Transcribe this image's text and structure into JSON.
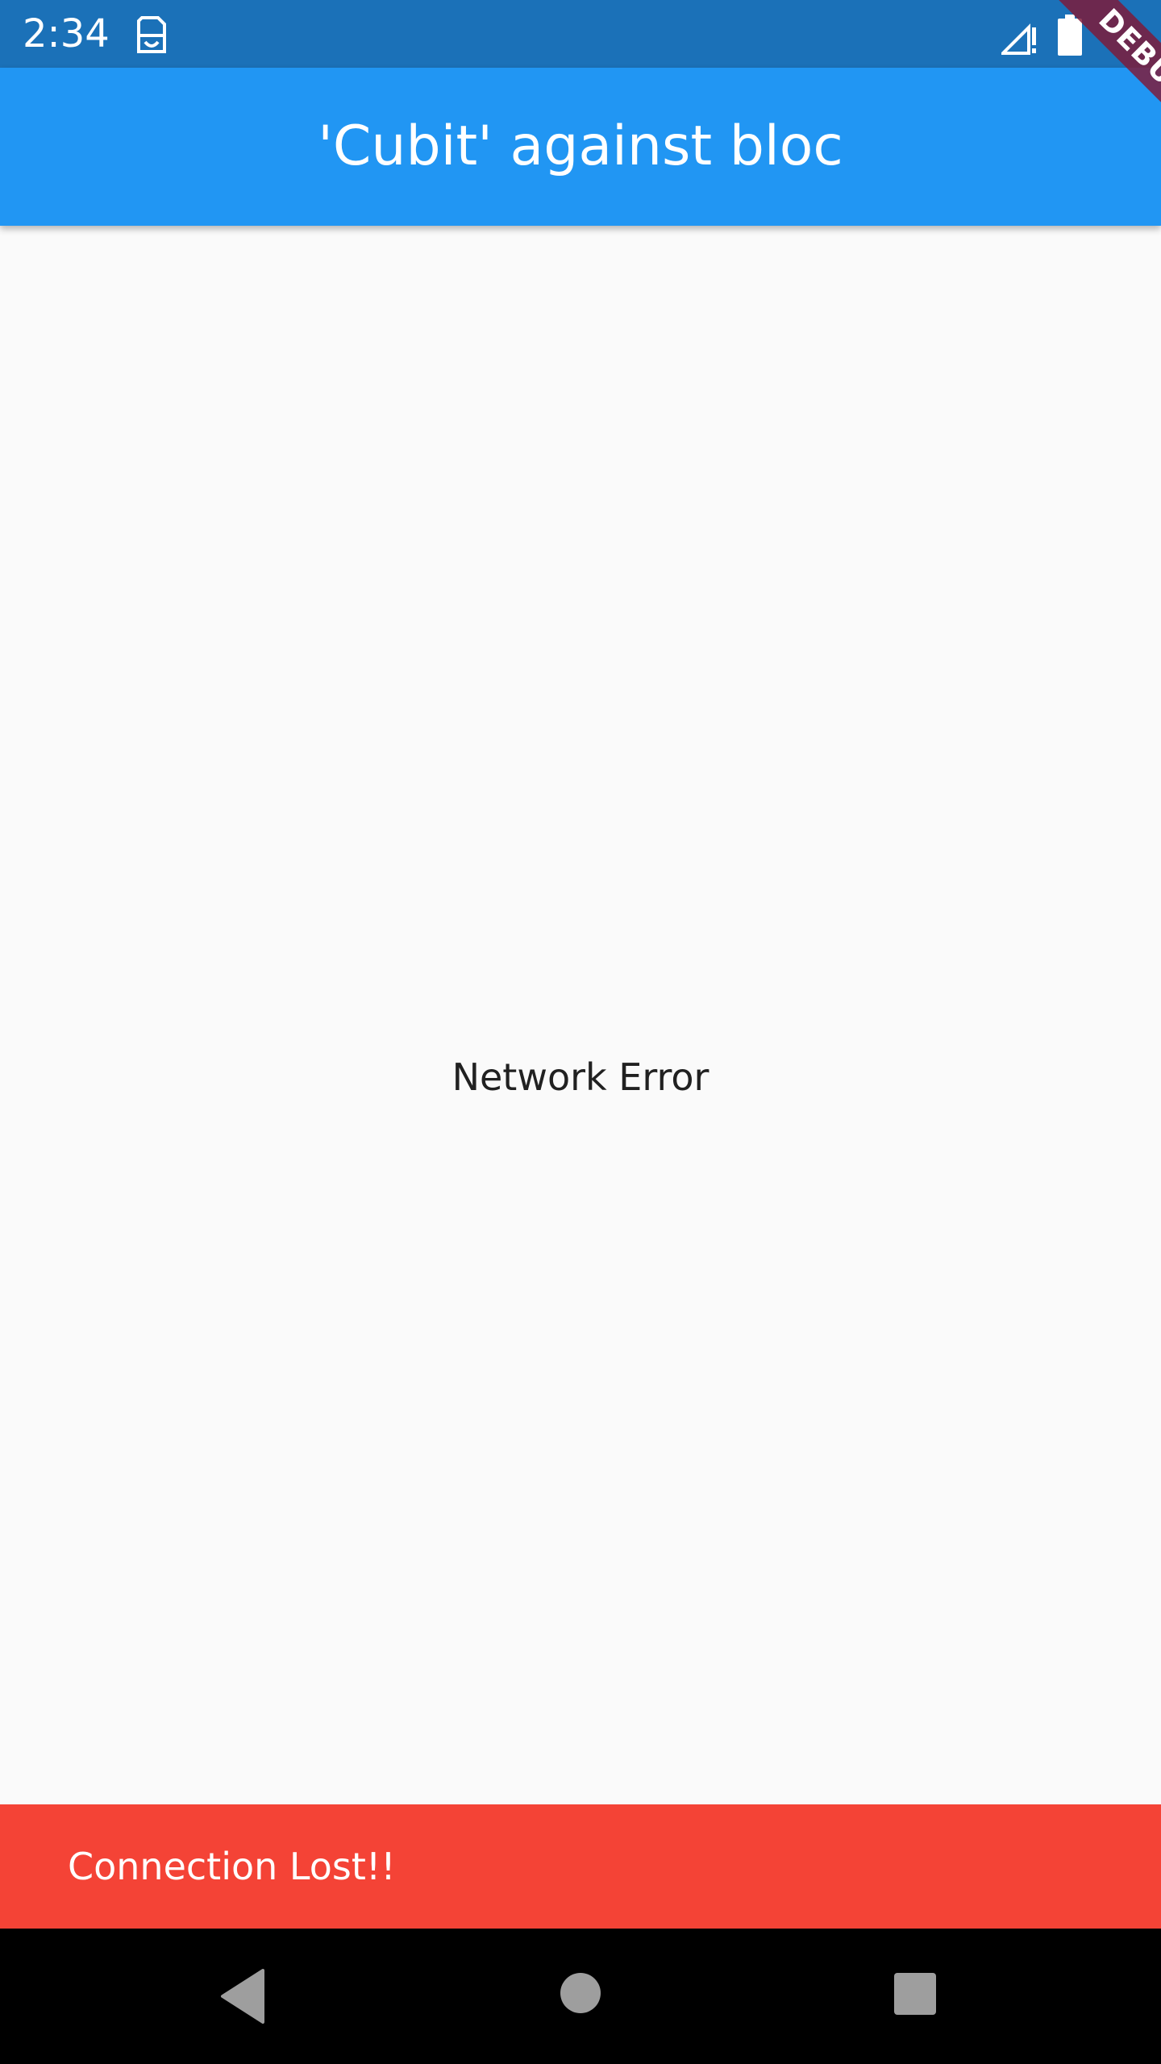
{
  "status_bar": {
    "time": "2:34",
    "notification_icon": "sim-card-icon",
    "signal_icon": "signal-no-data-icon",
    "battery_icon": "battery-full-icon"
  },
  "app_bar": {
    "title": "'Cubit' against bloc",
    "color": "#2196f3"
  },
  "main": {
    "message": "Network Error"
  },
  "snackbar": {
    "text": "Connection Lost!!",
    "color": "#f44336"
  },
  "nav_bar": {
    "back_icon": "back-triangle-icon",
    "home_icon": "home-circle-icon",
    "recents_icon": "recents-square-icon"
  },
  "debug_banner": {
    "label": "DEBUG"
  }
}
